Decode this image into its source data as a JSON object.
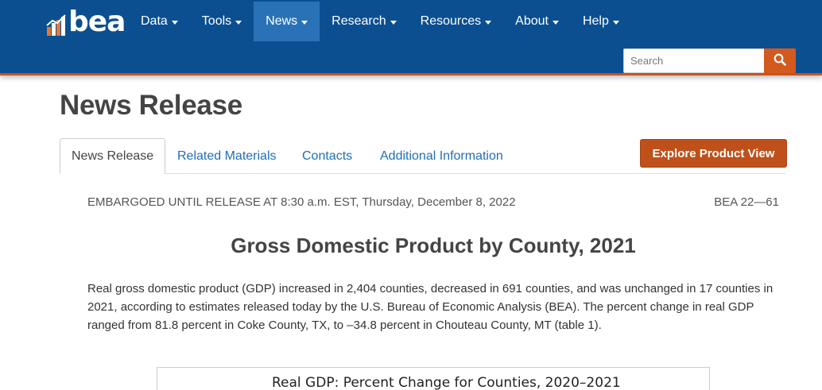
{
  "header": {
    "logo_text": "bea",
    "nav": [
      {
        "label": "Data",
        "active": false
      },
      {
        "label": "Tools",
        "active": false
      },
      {
        "label": "News",
        "active": true
      },
      {
        "label": "Research",
        "active": false
      },
      {
        "label": "Resources",
        "active": false
      },
      {
        "label": "About",
        "active": false
      },
      {
        "label": "Help",
        "active": false
      }
    ],
    "search": {
      "placeholder": "Search",
      "icon": "search-icon"
    }
  },
  "page": {
    "title": "News Release",
    "tabs": [
      {
        "label": "News Release",
        "active": true
      },
      {
        "label": "Related Materials",
        "active": false
      },
      {
        "label": "Contacts",
        "active": false
      },
      {
        "label": "Additional Information",
        "active": false
      }
    ],
    "explore_button": "Explore Product View"
  },
  "release": {
    "embargo": "EMBARGOED UNTIL RELEASE AT 8:30 a.m. EST, Thursday, December 8, 2022",
    "number": "BEA 22—61",
    "title": "Gross Domestic Product by County, 2021",
    "lead": "Real gross domestic product (GDP) increased in 2,404 counties, decreased in 691 counties, and was unchanged in 17 counties in 2021, according to estimates released today by the U.S. Bureau of Economic Analysis (BEA). The percent change in real GDP ranged from 81.8 percent in Coke County, TX, to –34.8 percent in Chouteau County, MT (table 1).",
    "chart_title": "Real GDP: Percent Change for Counties, 2020–2021"
  },
  "colors": {
    "nav_bg": "#0b4f91",
    "nav_active": "#2a72b8",
    "accent_orange": "#c0501a",
    "link_blue": "#1f6eb5"
  }
}
